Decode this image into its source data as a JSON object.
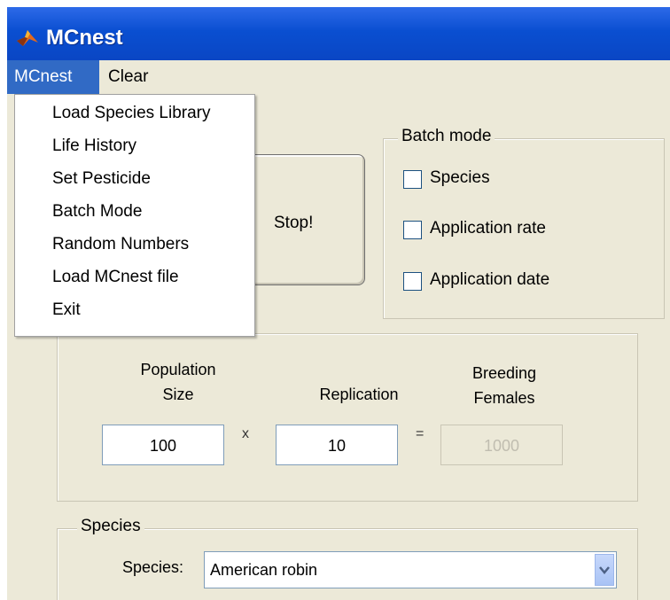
{
  "window": {
    "title": "MCnest",
    "icon": "matlab-logo-icon"
  },
  "menubar": {
    "items": [
      "MCnest",
      "Clear"
    ],
    "active_index": 0
  },
  "dropdown": {
    "items": [
      "Load Species Library",
      "Life History",
      "Set Pesticide",
      "Batch Mode",
      "Random Numbers",
      "Load MCnest file",
      "Exit"
    ]
  },
  "run": {
    "stop_label": "Stop!"
  },
  "batch": {
    "title": "Batch mode",
    "options": [
      {
        "label": "Species",
        "checked": false
      },
      {
        "label": "Application rate",
        "checked": false
      },
      {
        "label": "Application date",
        "checked": false
      }
    ]
  },
  "iterations": {
    "population_label_1": "Population",
    "population_label_2": "Size",
    "replication_label": "Replication",
    "breeding_label_1": "Breeding",
    "breeding_label_2": "Females",
    "population_value": "100",
    "replication_value": "10",
    "breeding_value": "1000",
    "times_symbol": "x",
    "equals_symbol": "="
  },
  "species": {
    "title": "Species",
    "label": "Species:",
    "selected": "American robin"
  },
  "colors": {
    "title_bar": "#0a4fd1",
    "menu_highlight": "#316ac5",
    "face": "#ece9d8"
  }
}
